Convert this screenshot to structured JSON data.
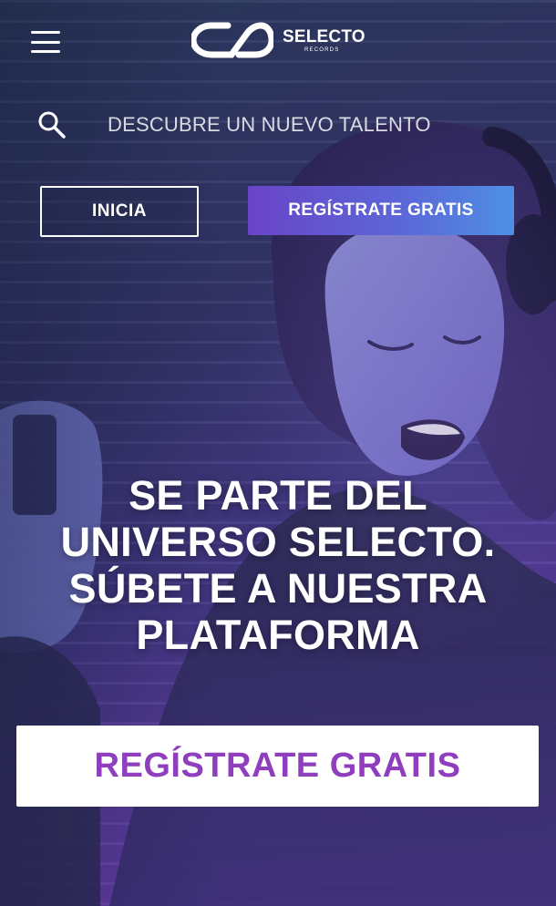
{
  "header": {
    "menu_icon": "hamburger-menu-icon",
    "logo": {
      "name": "SELECTO",
      "subtitle": "RECORDS"
    }
  },
  "search": {
    "icon": "search-icon",
    "placeholder": "DESCUBRE UN NUEVO TALENTO"
  },
  "buttons": {
    "login_label": "INICIA",
    "signup_top_label": "REGÍSTRATE GRATIS",
    "signup_main_label": "REGÍSTRATE GRATIS"
  },
  "hero": {
    "lines": [
      "SE PARTE DEL",
      "UNIVERSO SELECTO.",
      "SÚBETE A NUESTRA",
      "PLATAFORMA"
    ]
  },
  "colors": {
    "accent_purple": "#8f3fbd",
    "gradient_start": "#6a44c7",
    "gradient_end": "#4e90e4"
  }
}
